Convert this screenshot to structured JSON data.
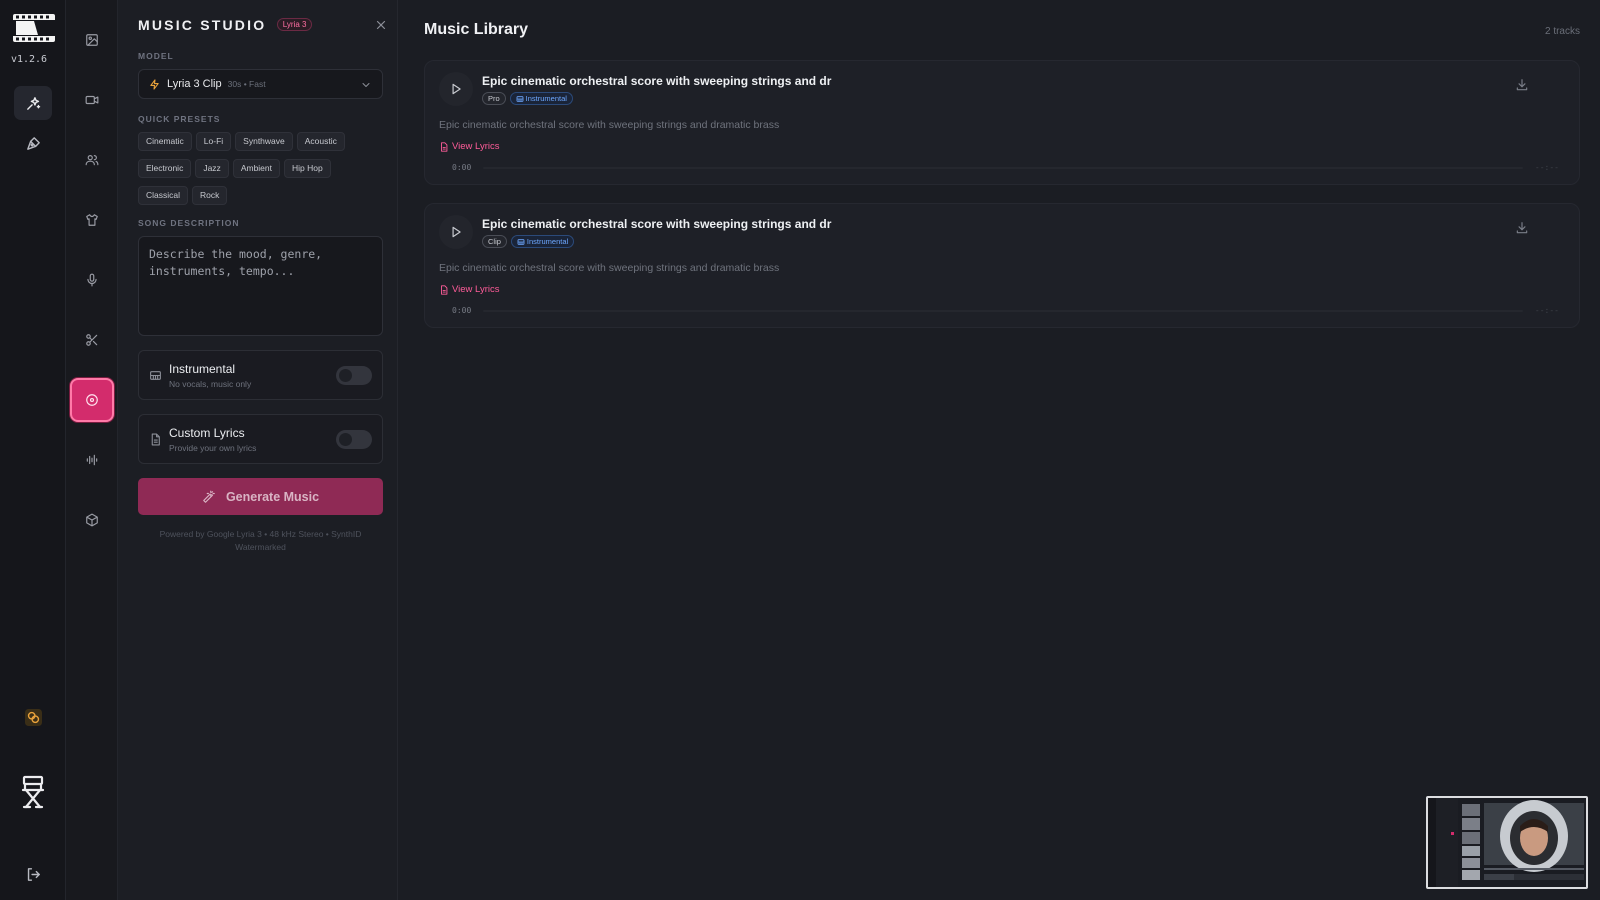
{
  "rail": {
    "version": "v1.2.6",
    "icons": [
      "film-logo-icon",
      "sparkle-wand-icon",
      "pen-tool-icon",
      "credits-coins-icon",
      "director-chair-icon",
      "logout-icon"
    ]
  },
  "tools": {
    "icons": [
      "image-icon",
      "video-icon",
      "users-icon",
      "shirt-icon",
      "microphone-icon",
      "scissors-icon",
      "music-disc-icon",
      "audio-wave-icon",
      "cube-icon"
    ],
    "active": "music-disc-icon"
  },
  "panel": {
    "title": "MUSIC STUDIO",
    "badge": "Lyria 3",
    "model_label": "MODEL",
    "model": {
      "name": "Lyria 3 Clip",
      "meta": "30s • Fast"
    },
    "presets_label": "QUICK PRESETS",
    "presets": [
      "Cinematic",
      "Lo-Fi",
      "Synthwave",
      "Acoustic",
      "Electronic",
      "Jazz",
      "Ambient",
      "Hip Hop",
      "Classical",
      "Rock"
    ],
    "description_label": "SONG DESCRIPTION",
    "description_placeholder": "Describe the mood, genre, instruments, tempo...",
    "instrumental": {
      "title": "Instrumental",
      "subtitle": "No vocals, music only",
      "enabled": false
    },
    "custom_lyrics": {
      "title": "Custom Lyrics",
      "subtitle": "Provide your own lyrics",
      "enabled": false
    },
    "generate_label": "Generate Music",
    "powered_by": "Powered by Google Lyria 3 • 48 kHz Stereo • SynthID Watermarked"
  },
  "library": {
    "title": "Music Library",
    "count": "2 tracks",
    "view_lyrics_label": "View Lyrics",
    "tracks": [
      {
        "title": "Epic cinematic orchestral score with sweeping strings and dr",
        "quality": "Pro",
        "type_tag": "Instrumental",
        "description": "Epic cinematic orchestral score with sweeping strings and dramatic brass",
        "current_time": "0:00",
        "end_time": "--:--"
      },
      {
        "title": "Epic cinematic orchestral score with sweeping strings and dr",
        "quality": "Clip",
        "type_tag": "Instrumental",
        "description": "Epic cinematic orchestral score with sweeping strings and dramatic brass",
        "current_time": "0:00",
        "end_time": "--:--"
      }
    ]
  },
  "colors": {
    "accent": "#d32c6c",
    "background": "#1b1d23",
    "instrumental_tag": "#6ea8ff"
  }
}
